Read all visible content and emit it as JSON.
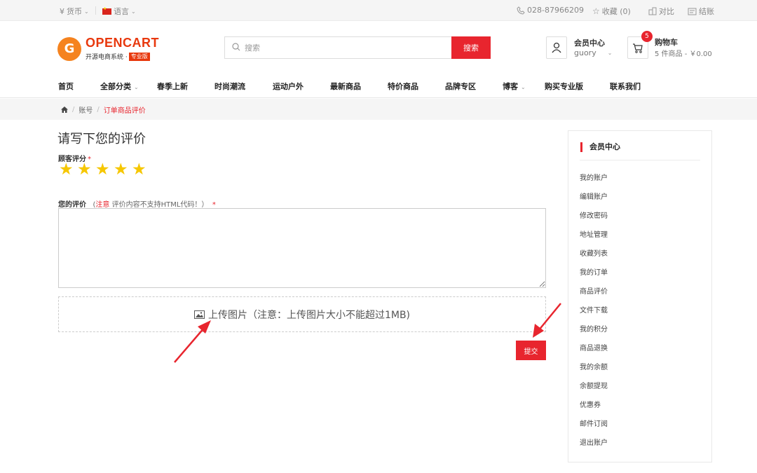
{
  "topbar": {
    "currency": "货币",
    "language": "语言",
    "phone": "028-87966209",
    "wishlist": "收藏 (0)",
    "compare": "对比",
    "checkout": "结账"
  },
  "brand": {
    "name": "OPENCART",
    "subtitle": "开源电商系统 ·",
    "edition": "专业版"
  },
  "search": {
    "placeholder": "搜索",
    "button": "搜索"
  },
  "account": {
    "title": "会员中心",
    "username": "guory"
  },
  "cart": {
    "title": "购物车",
    "count": "5",
    "summary": "5 件商品 - ￥0.00"
  },
  "nav": [
    "首页",
    "全部分类",
    "春季上新",
    "时尚潮流",
    "运动户外",
    "最新商品",
    "特价商品",
    "品牌专区",
    "博客",
    "购买专业版",
    "联系我们"
  ],
  "breadcrumb": {
    "account": "账号",
    "current": "订单商品评价"
  },
  "form": {
    "heading": "请写下您的评价",
    "rating_label": "顾客评分",
    "rating": 5,
    "review_label": "您的评价",
    "note_prefix": "注意",
    "note_text": "评价内容不支持HTML代码！）",
    "upload_label": "上传图片（注意：上传图片大小不能超过1MB)",
    "submit": "提交"
  },
  "sidebar": {
    "title": "会员中心",
    "items": [
      "我的账户",
      "编辑账户",
      "修改密码",
      "地址管理",
      "收藏列表",
      "我的订单",
      "商品评价",
      "文件下载",
      "我的积分",
      "商品退换",
      "我的余额",
      "余额提现",
      "优惠券",
      "邮件订阅",
      "退出账户"
    ]
  },
  "colors": {
    "accent": "#e8252e",
    "brand": "#f5831f",
    "star": "#f6c700"
  }
}
